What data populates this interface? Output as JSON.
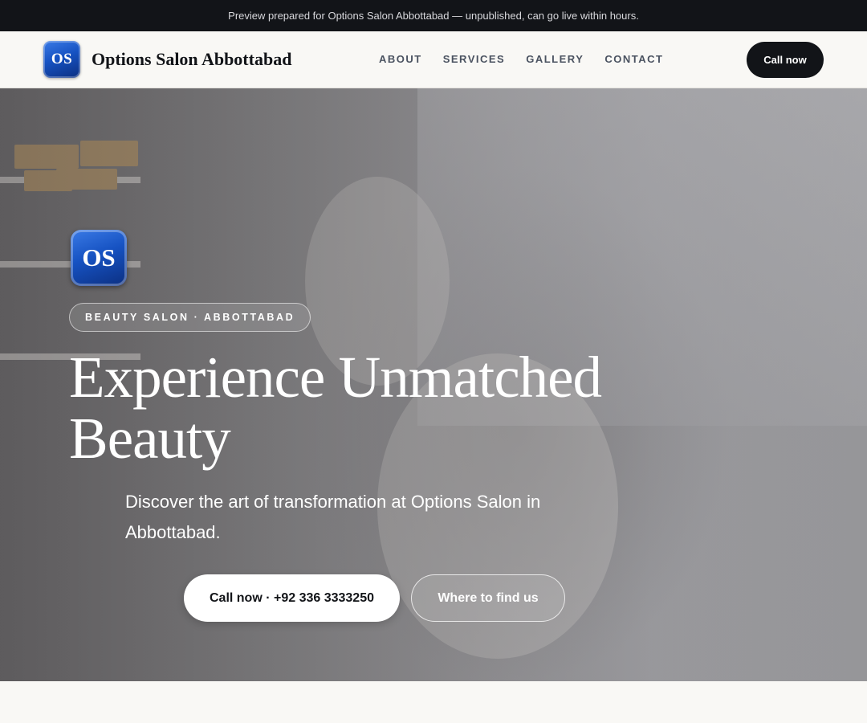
{
  "announcement": "Preview prepared for Options Salon Abbottabad — unpublished, can go live within hours.",
  "header": {
    "logo_text": "OS",
    "brand_name": "Options Salon Abbottabad",
    "nav": [
      {
        "label": "ABOUT"
      },
      {
        "label": "SERVICES"
      },
      {
        "label": "GALLERY"
      },
      {
        "label": "CONTACT"
      }
    ],
    "cta_label": "Call now"
  },
  "hero": {
    "logo_text": "OS",
    "badge": "BEAUTY SALON · ABBOTTABAD",
    "headline": "Experience Unmatched Beauty",
    "subtitle": "Discover the art of transformation at Options Salon in Abbottabad.",
    "primary_button": "Call now · +92 336 3333250",
    "secondary_button": "Where to find us"
  },
  "colors": {
    "dark": "#121418",
    "background": "#f9f8f5",
    "logo_blue": "#1652c2",
    "nav_text": "#4a5260"
  }
}
